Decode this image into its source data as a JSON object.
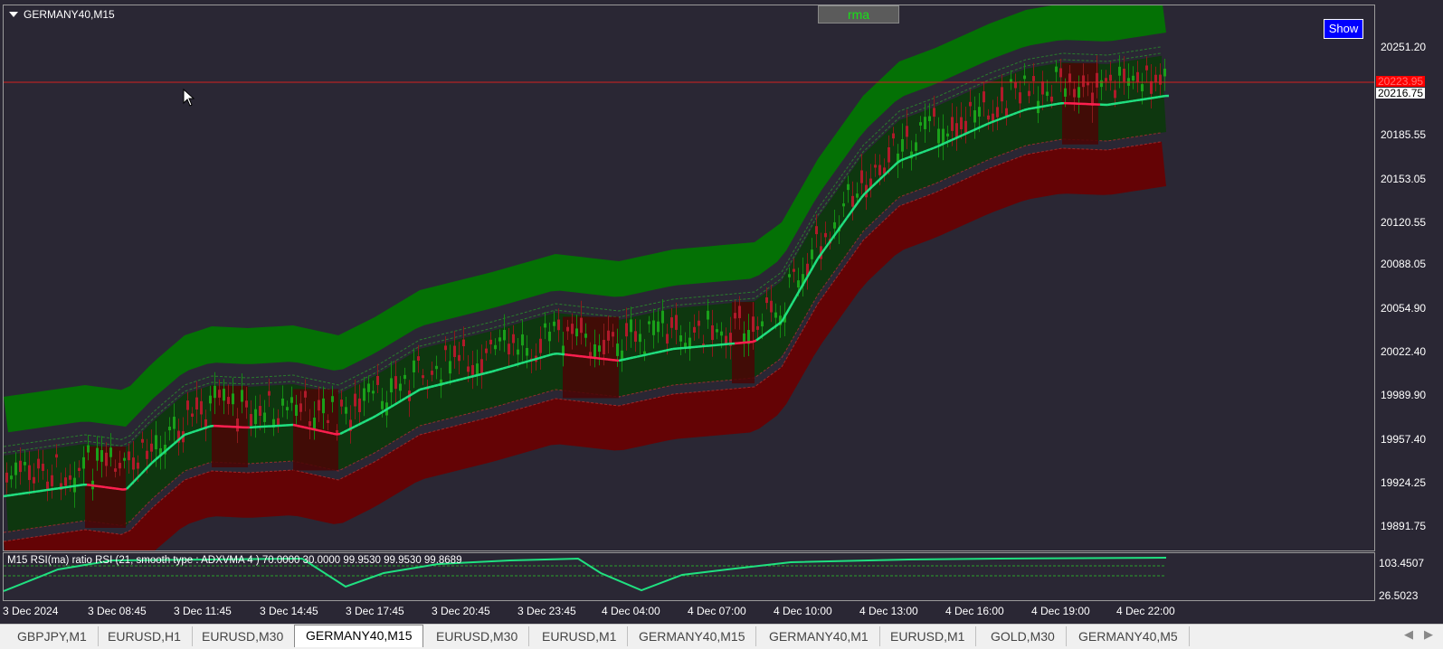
{
  "window": {
    "title": "GERMANY40,M15"
  },
  "buttons": {
    "rma_label": "rma",
    "show_label": "Show"
  },
  "colors": {
    "background": "#2a2734",
    "bull_band": "#007a00",
    "bear_band": "#6a0000",
    "ma_line_up": "#20e080",
    "ma_line_down": "#ff2050",
    "bid_line": "#d42020"
  },
  "price_axis": {
    "labels": [
      "20251.20",
      "20185.55",
      "20153.05",
      "20120.55",
      "20088.05",
      "20054.90",
      "20022.40",
      "19989.90",
      "19957.40",
      "19924.25",
      "19891.75"
    ],
    "current_price_red": "20223.95",
    "current_price_white": "20216.75"
  },
  "rsi_panel": {
    "label": "M15 RSI(ma) ratio RSI (21, smooth type : ADXVMA  4 ) 70.0000 30.0000 99.9530 99.9530 99.8689",
    "scale_top": "103.4507",
    "scale_bottom": "26.5023"
  },
  "time_axis": {
    "labels": [
      "3 Dec 2024",
      "3 Dec 08:45",
      "3 Dec 11:45",
      "3 Dec 14:45",
      "3 Dec 17:45",
      "3 Dec 20:45",
      "3 Dec 23:45",
      "4 Dec 04:00",
      "4 Dec 07:00",
      "4 Dec 10:00",
      "4 Dec 13:00",
      "4 Dec 16:00",
      "4 Dec 19:00",
      "4 Dec 22:00"
    ]
  },
  "tabs": [
    {
      "label": "GBPJPY,M1",
      "active": false
    },
    {
      "label": "EURUSD,H1",
      "active": false
    },
    {
      "label": "EURUSD,M30",
      "active": false
    },
    {
      "label": "GERMANY40,M15",
      "active": true
    },
    {
      "label": "EURUSD,M30",
      "active": false
    },
    {
      "label": "EURUSD,M1",
      "active": false
    },
    {
      "label": "GERMANY40,M15",
      "active": false
    },
    {
      "label": "GERMANY40,M1",
      "active": false
    },
    {
      "label": "EURUSD,M1",
      "active": false
    },
    {
      "label": "GOLD,M30",
      "active": false
    },
    {
      "label": "GERMANY40,M5",
      "active": false
    }
  ],
  "icons": {
    "menu": "triangle-down-icon",
    "cursor": "mouse-pointer-icon",
    "scroll_left": "chevron-left-icon",
    "scroll_right": "chevron-right-icon"
  }
}
